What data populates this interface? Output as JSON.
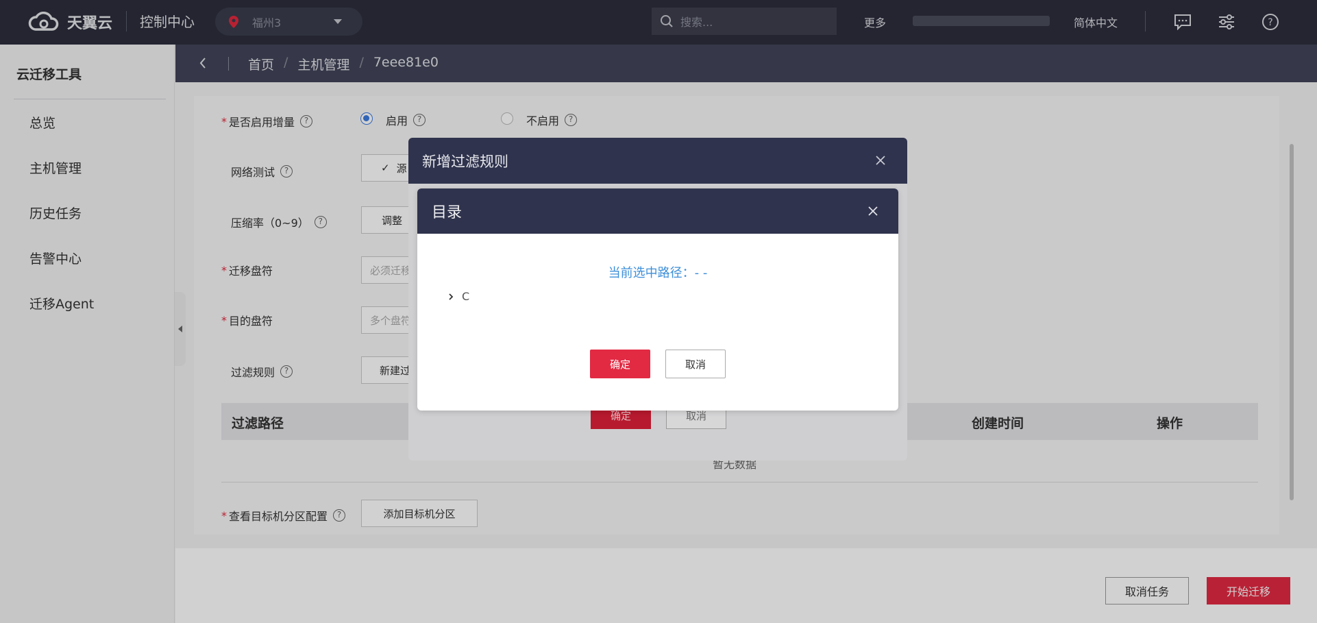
{
  "header": {
    "brand": "天翼云",
    "console": "控制中心",
    "region": "福州3",
    "search_placeholder": "搜索...",
    "more": "更多",
    "language": "简体中文"
  },
  "sidebar": {
    "title": "云迁移工具",
    "items": [
      {
        "label": "总览"
      },
      {
        "label": "主机管理"
      },
      {
        "label": "历史任务"
      },
      {
        "label": "告警中心"
      },
      {
        "label": "迁移Agent"
      }
    ]
  },
  "breadcrumb": {
    "items": [
      "首页",
      "主机管理",
      "7eee81e0"
    ],
    "separator": "/"
  },
  "form": {
    "incremental": {
      "label": "是否启用增量",
      "enable": "启用",
      "disable": "不启用",
      "selected": "启用"
    },
    "network_test": {
      "label": "网络测试",
      "button": "源"
    },
    "compression": {
      "label": "压缩率（0~9）",
      "button": "调整"
    },
    "migrate_drive": {
      "label": "迁移盘符",
      "placeholder": "必须迁移"
    },
    "target_drive": {
      "label": "目的盘符",
      "placeholder": "多个盘符"
    },
    "filter_rule": {
      "label": "过滤规则",
      "button": "新建过"
    },
    "table": {
      "headers": [
        "过滤路径",
        "创建时间",
        "操作"
      ],
      "empty": "暂无数据"
    },
    "partition": {
      "label": "查看目标机分区配置",
      "button": "添加目标机分区"
    }
  },
  "footer": {
    "cancel_task": "取消任务",
    "start_migration": "开始迁移"
  },
  "outer_dialog": {
    "title": "新增过滤规则",
    "ok": "确定",
    "cancel": "取消"
  },
  "inner_dialog": {
    "title": "目录",
    "current_path": "当前选中路径：- -",
    "tree": [
      {
        "label": "C"
      }
    ],
    "ok": "确定",
    "cancel": "取消"
  },
  "colors": {
    "primary_red": "#e22a43",
    "link_blue": "#3d8fd9",
    "dialog_header": "#2f334d",
    "topbar": "#2c2e3c"
  }
}
